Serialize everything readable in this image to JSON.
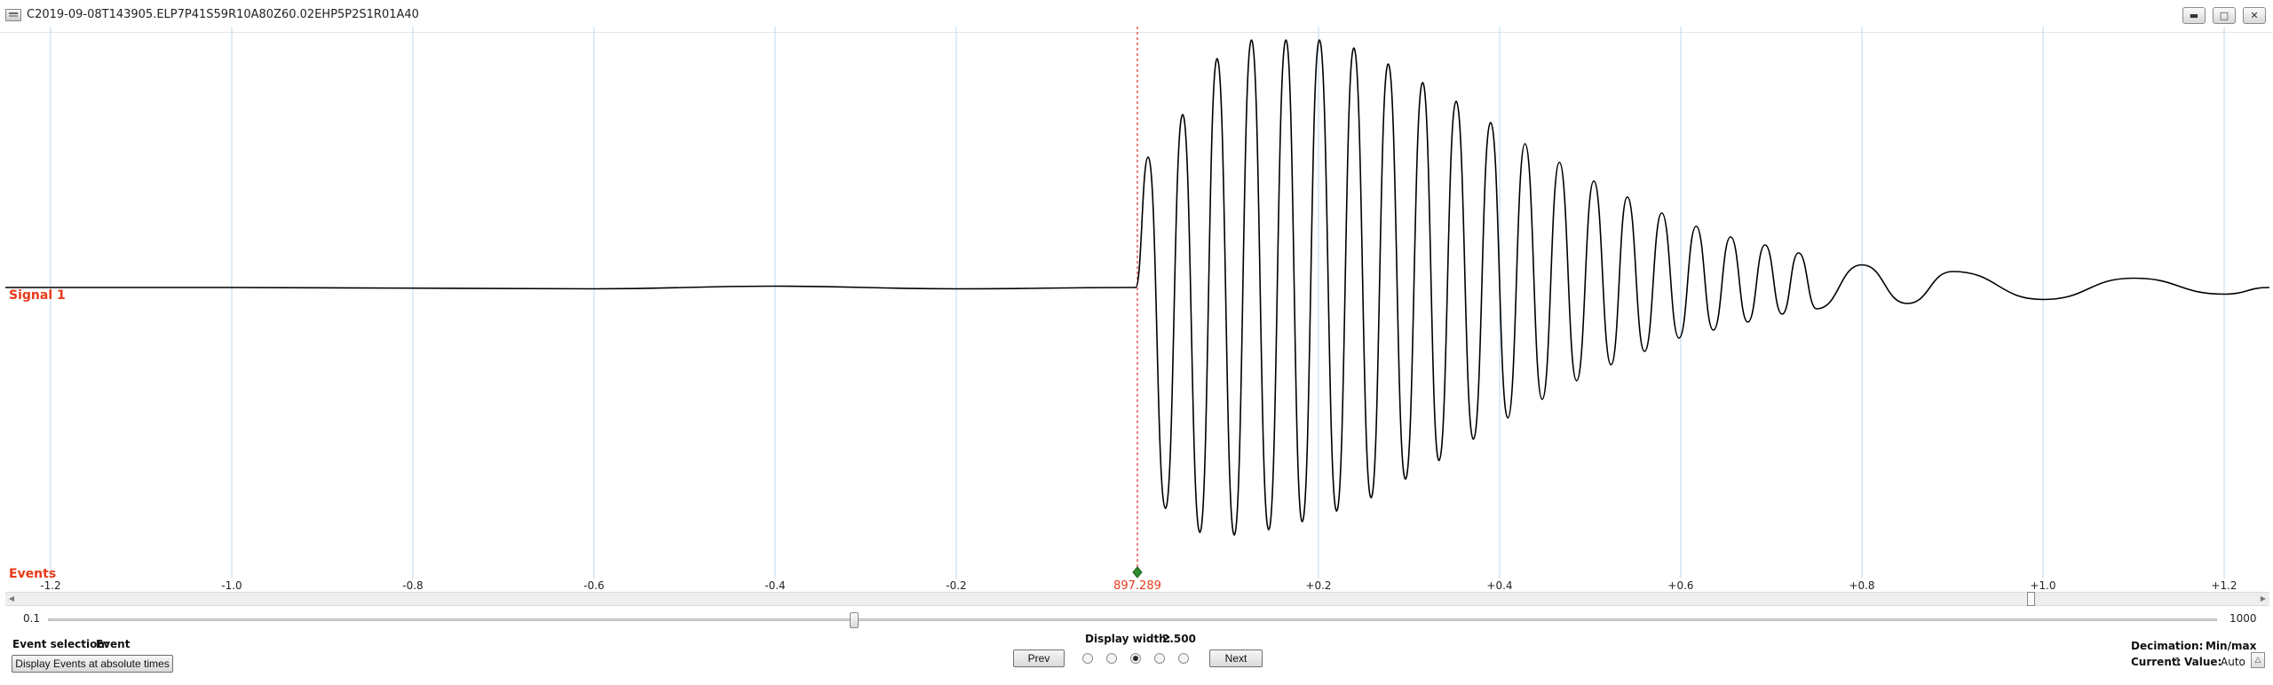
{
  "window": {
    "title": "C2019-09-08T143905.ELP7P41S59R10A80Z60.02EHP5P2S1R01A40",
    "icon": "signal-file-icon",
    "controls": [
      "minimize-icon",
      "maximize-icon",
      "close-icon"
    ]
  },
  "plot": {
    "signal_label": "Signal 1",
    "events_label": "Events",
    "event_marker_label": "897.289",
    "colors": {
      "trace": "#000000",
      "labels": "#e8391a",
      "grid": "#c7dff0",
      "marker": "#e03030",
      "event_diamond": "#2e8b2e"
    }
  },
  "chart_data": {
    "type": "line",
    "series": [
      {
        "values": [
          [
            -1.25,
            0.0
          ],
          [
            -1.0,
            0.0
          ],
          [
            -0.6,
            -0.005
          ],
          [
            -0.4,
            0.005
          ],
          [
            -0.2,
            -0.005
          ],
          [
            -0.002,
            0.0
          ],
          [
            0.012,
            0.49
          ],
          [
            0.031,
            -0.83
          ],
          [
            0.05,
            0.65
          ],
          [
            0.069,
            -0.92
          ],
          [
            0.088,
            0.86
          ],
          [
            0.107,
            -0.93
          ],
          [
            0.126,
            0.93
          ],
          [
            0.145,
            -0.91
          ],
          [
            0.164,
            0.93
          ],
          [
            0.182,
            -0.88
          ],
          [
            0.201,
            0.93
          ],
          [
            0.22,
            -0.84
          ],
          [
            0.239,
            0.9
          ],
          [
            0.258,
            -0.79
          ],
          [
            0.277,
            0.84
          ],
          [
            0.296,
            -0.72
          ],
          [
            0.315,
            0.77
          ],
          [
            0.333,
            -0.65
          ],
          [
            0.352,
            0.7
          ],
          [
            0.371,
            -0.57
          ],
          [
            0.39,
            0.62
          ],
          [
            0.409,
            -0.49
          ],
          [
            0.428,
            0.54
          ],
          [
            0.447,
            -0.42
          ],
          [
            0.466,
            0.47
          ],
          [
            0.485,
            -0.35
          ],
          [
            0.504,
            0.4
          ],
          [
            0.523,
            -0.29
          ],
          [
            0.541,
            0.34
          ],
          [
            0.56,
            -0.24
          ],
          [
            0.579,
            0.28
          ],
          [
            0.598,
            -0.19
          ],
          [
            0.617,
            0.23
          ],
          [
            0.636,
            -0.16
          ],
          [
            0.655,
            0.19
          ],
          [
            0.674,
            -0.13
          ],
          [
            0.693,
            0.16
          ],
          [
            0.712,
            -0.1
          ],
          [
            0.73,
            0.13
          ],
          [
            0.75,
            -0.08
          ],
          [
            0.8,
            0.085
          ],
          [
            0.85,
            -0.06
          ],
          [
            0.9,
            0.06
          ],
          [
            1.0,
            -0.045
          ],
          [
            1.1,
            0.035
          ],
          [
            1.2,
            -0.025
          ],
          [
            1.25,
            0.0
          ]
        ]
      }
    ],
    "x_ticks": [
      "-1.2",
      "-1.0",
      "-0.8",
      "-0.6",
      "-0.4",
      "-0.2",
      "897.289",
      "+0.2",
      "+0.4",
      "+0.6",
      "+0.8",
      "+1.0",
      "+1.2"
    ],
    "grid": true
  },
  "controls": {
    "zoom_min": "0.1",
    "zoom_max": "1000",
    "zoom_value": 0.43,
    "scroll_position": 0.894,
    "event_selection_label": "Event selection:",
    "event_selection_value": "Event",
    "absolute_times_button": "Display Events at absolute times",
    "display_width_label": "Display width:",
    "display_width_value": "2.500",
    "prev_button": "Prev",
    "next_button": "Next",
    "radio_selected_index": 2,
    "decimation_label": "Decimation:",
    "decimation_value": "Min/max",
    "current_label": "Current:",
    "current_value": "1",
    "value_label": "Value:",
    "value_value": "Auto",
    "auto_button_icon": "triangle-up-icon"
  }
}
